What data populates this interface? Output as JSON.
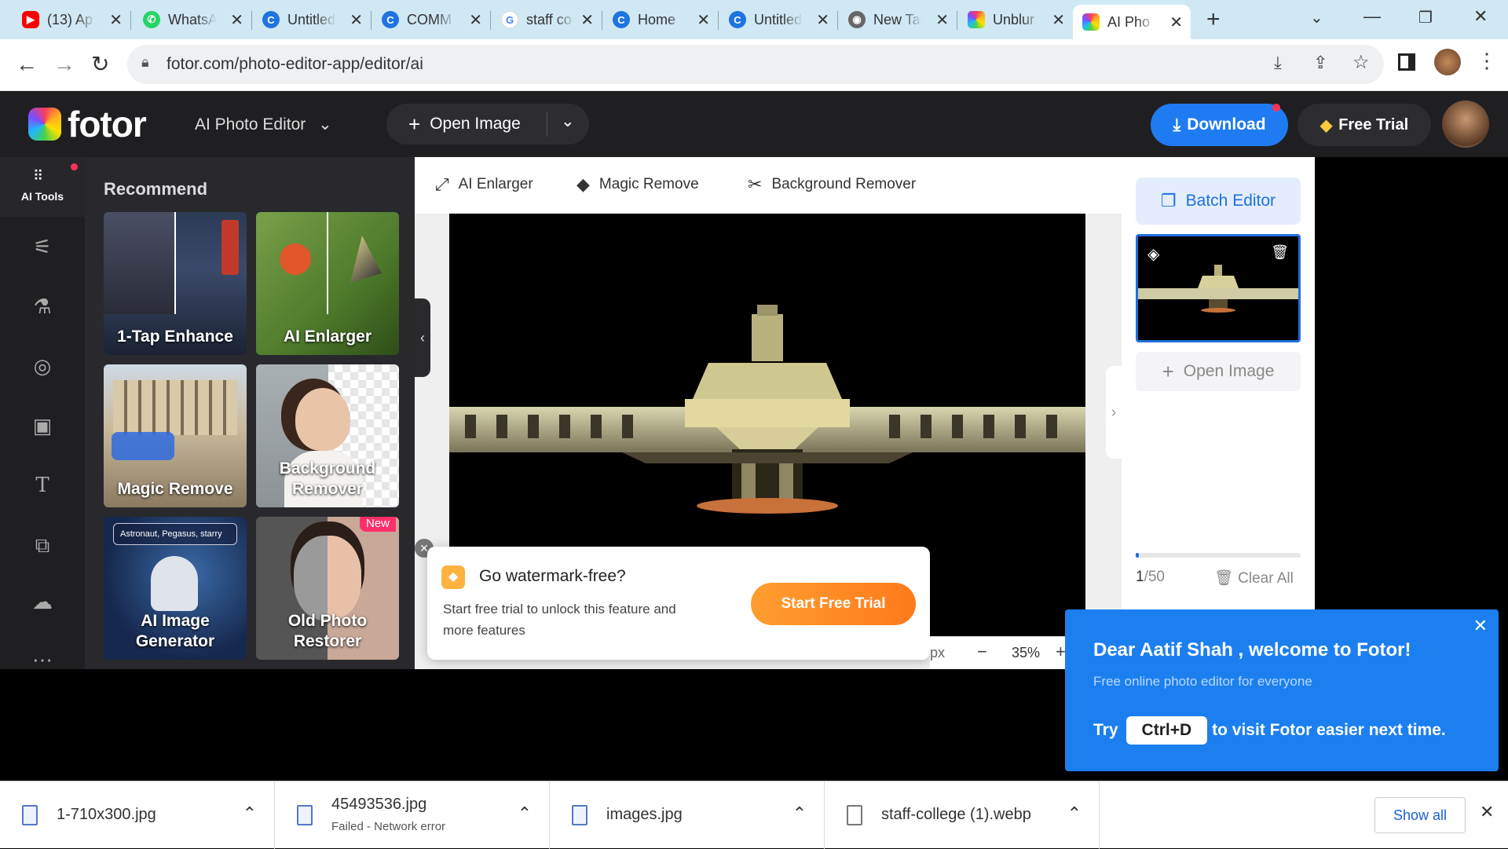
{
  "browser": {
    "tabs": [
      {
        "title": "(13) Ap",
        "icon": "youtube-icon",
        "color": "#ff0000"
      },
      {
        "title": "WhatsApp",
        "icon": "whatsapp-icon",
        "color": "#25d366"
      },
      {
        "title": "Untitled",
        "icon": "canva-icon",
        "color": "#1f74e0"
      },
      {
        "title": "COMM",
        "icon": "canva-icon",
        "color": "#1f74e0"
      },
      {
        "title": "staff co",
        "icon": "google-icon",
        "color": "#4285f4"
      },
      {
        "title": "Home",
        "icon": "canva-icon",
        "color": "#1f74e0"
      },
      {
        "title": "Untitled",
        "icon": "canva-icon",
        "color": "#1f74e0"
      },
      {
        "title": "New Tab",
        "icon": "chrome-icon",
        "color": "#555555"
      },
      {
        "title": "Unblur",
        "icon": "fotor-icon",
        "color": "#ffb21d"
      },
      {
        "title": "AI Pho",
        "icon": "fotor-icon",
        "color": "#ffb21d",
        "active": true
      }
    ],
    "new_tab": "+",
    "url": "fotor.com/photo-editor-app/editor/ai"
  },
  "header": {
    "logo_text": "fotor",
    "editor_select": "AI Photo Editor",
    "open_image": "Open Image",
    "download": "Download",
    "free_trial": "Free Trial"
  },
  "rail": {
    "ai_tools": "AI Tools"
  },
  "panel": {
    "title": "Recommend",
    "cards": [
      {
        "label": "1-Tap Enhance"
      },
      {
        "label": "AI Enlarger"
      },
      {
        "label": "Magic Remove"
      },
      {
        "label": "Background Remover"
      },
      {
        "label": "AI Image Generator",
        "prompt": "Astronaut, Pegasus, starry"
      },
      {
        "label": "Old Photo Restorer",
        "badge": "New"
      }
    ]
  },
  "toolbar": {
    "items": [
      "AI Enlarger",
      "Magic Remove",
      "Background Remover"
    ]
  },
  "watermark": {
    "title": "Go watermark-free?",
    "body": "Start free trial to unlock this feature and more features",
    "cta": "Start Free Trial"
  },
  "zoom": {
    "unit": "px",
    "value": "35%",
    "minus": "−",
    "plus": "+"
  },
  "right": {
    "batch": "Batch Editor",
    "open_image": "Open Image",
    "count_current": "1",
    "count_total": "/50",
    "clear_all": "Clear All",
    "progress": 0.02
  },
  "welcome": {
    "title": "Dear Aatif Shah , welcome to Fotor!",
    "subtitle": "Free online photo editor for everyone",
    "try": "Try",
    "shortcut": "Ctrl+D",
    "rest": "to visit Fotor easier next time."
  },
  "downloads": {
    "items": [
      {
        "name": "1-710x300.jpg",
        "status": ""
      },
      {
        "name": "45493536.jpg",
        "status": "Failed - Network error"
      },
      {
        "name": "images.jpg",
        "status": ""
      },
      {
        "name": "staff-college (1).webp",
        "status": ""
      }
    ],
    "show_all": "Show all"
  }
}
